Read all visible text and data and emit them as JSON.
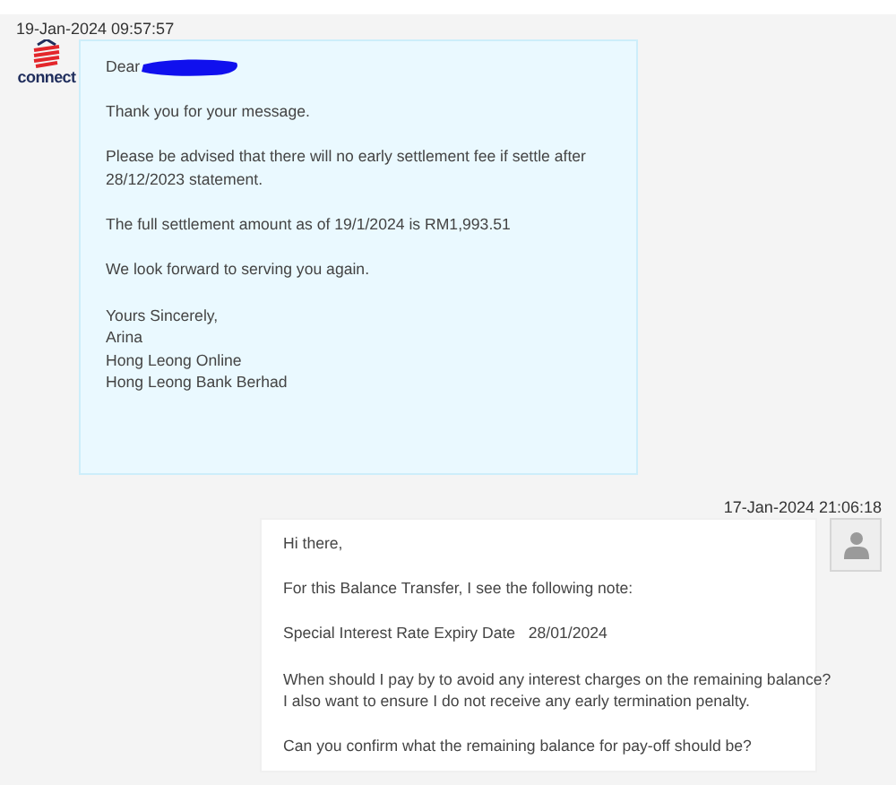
{
  "messages": [
    {
      "kind": "received",
      "timestamp": "19-Jan-2024 09:57:57",
      "logo_text": "connect",
      "greeting": {
        "text": "Dear",
        "redacted": true
      },
      "paragraphs": [
        [
          "Thank you for your message."
        ],
        [
          "Please be advised that there will no early settlement fee if settle after",
          "28/12/2023 statement."
        ],
        [
          "The full settlement amount as of 19/1/2024 is RM1,993.51"
        ],
        [
          "We look forward to serving you again."
        ],
        [
          "Yours Sincerely,",
          "Arina",
          "Hong Leong Online",
          "Hong Leong Bank Berhad"
        ]
      ]
    },
    {
      "kind": "sent",
      "timestamp": "17-Jan-2024 21:06:18",
      "greeting": {
        "text": "Hi there,",
        "redacted": false
      },
      "paragraphs": [
        [
          "For this Balance Transfer, I see the following note:"
        ],
        [
          "Special Interest Rate Expiry Date   28/01/2024"
        ],
        [
          "When should I pay by to avoid any interest charges on the remaining balance?",
          "I also want to ensure I do not receive any early termination penalty."
        ],
        [
          "Can you confirm what the remaining balance for pay-off should be?"
        ]
      ]
    }
  ]
}
